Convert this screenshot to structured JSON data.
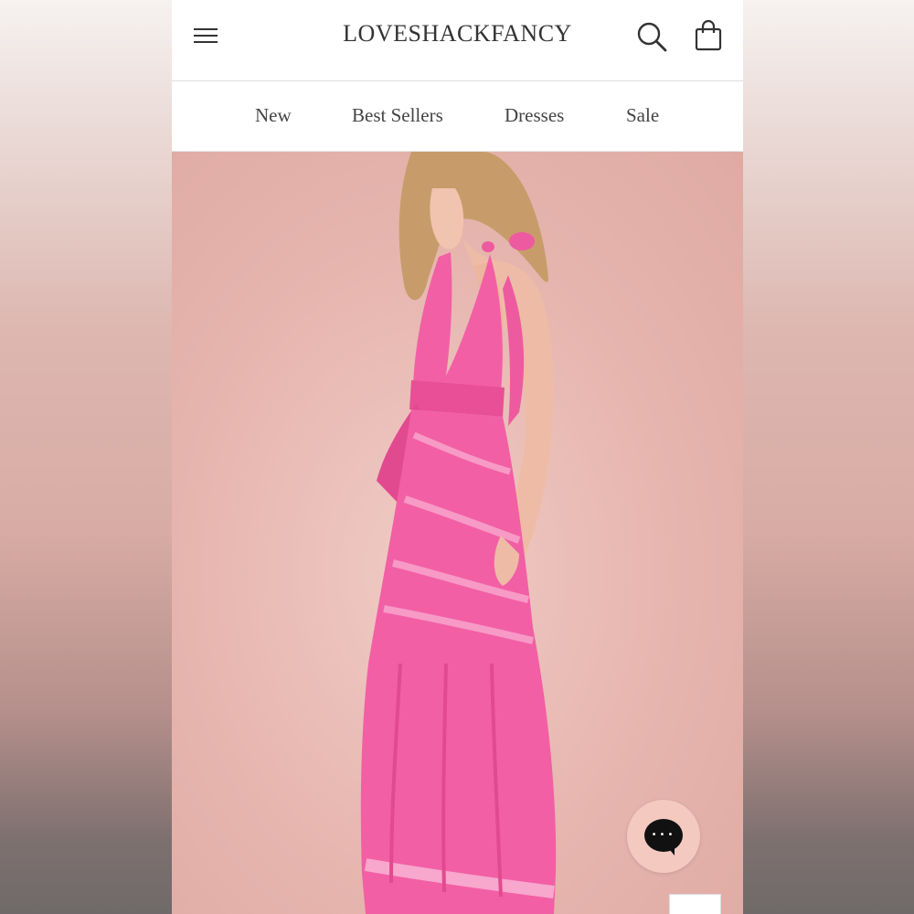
{
  "header": {
    "logo": "LOVESHACKFANCY",
    "icons": [
      "menu-icon",
      "search-icon",
      "shopping-bag-icon"
    ]
  },
  "nav": {
    "items": [
      {
        "label": "New"
      },
      {
        "label": "Best Sellers"
      },
      {
        "label": "Dresses"
      },
      {
        "label": "Sale"
      }
    ]
  },
  "chat": {
    "icon": "chat-bubble-icon",
    "dots": "•••"
  },
  "colors": {
    "background": "#f2d2cd",
    "dress": "#f25fa5",
    "chat_button": "#f3c9c0"
  }
}
